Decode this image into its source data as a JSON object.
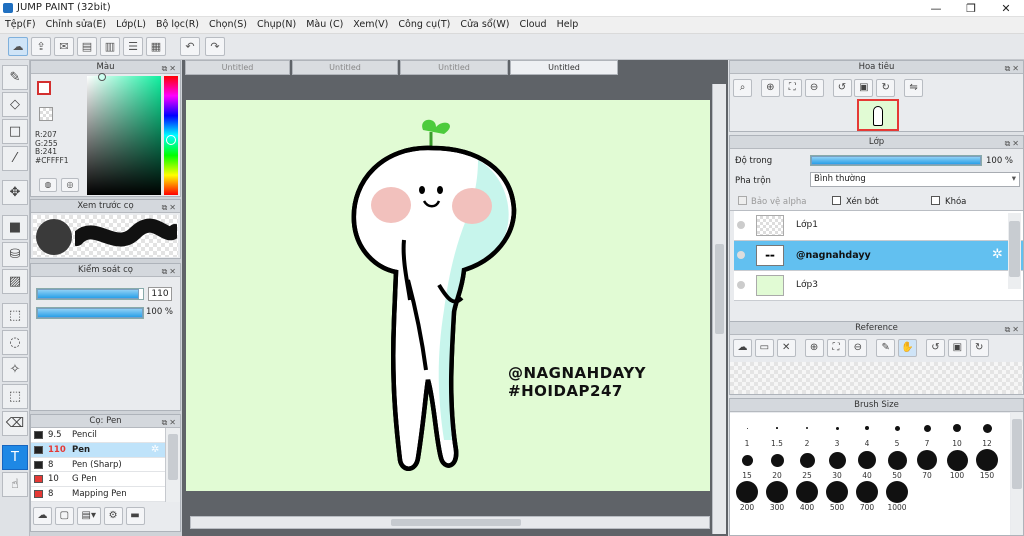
{
  "app": {
    "title": "JUMP PAINT (32bit)"
  },
  "window": {
    "minimize": "—",
    "restore": "❐",
    "close": "✕"
  },
  "menu": [
    "Tệp(F)",
    "Chỉnh sửa(E)",
    "Lớp(L)",
    "Bộ lọc(R)",
    "Chọn(S)",
    "Chụp(N)",
    "Màu (C)",
    "Xem(V)",
    "Công cụ(T)",
    "Cửa sổ(W)",
    "Cloud",
    "Help"
  ],
  "doc_tabs": [
    "Untitled",
    "Untitled",
    "Untitled",
    "Untitled"
  ],
  "color_panel": {
    "title": "Màu",
    "r": "R:207",
    "g": "G:255",
    "b": "B:241",
    "hex": "#CFFFF1",
    "current_color": "#cffff1"
  },
  "preview_panel": {
    "title": "Xem trước cọ"
  },
  "brush_control": {
    "title": "Kiểm soát cọ",
    "size_value": "110",
    "opacity_value": "100 %",
    "size_fraction": 0.96,
    "opacity_fraction": 1.0
  },
  "brush_list": {
    "title": "Cọ: Pen",
    "items": [
      {
        "size": "9.5",
        "name": "Pencil",
        "color": "#222222"
      },
      {
        "size": "110",
        "name": "Pen",
        "color": "#222222"
      },
      {
        "size": "8",
        "name": "Pen (Sharp)",
        "color": "#222222"
      },
      {
        "size": "10",
        "name": "G Pen",
        "color": "#e53935"
      },
      {
        "size": "8",
        "name": "Mapping Pen",
        "color": "#e53935"
      }
    ]
  },
  "canvas": {
    "text_line1": "@NAGNAHDAYY",
    "text_line2": "#HOIDAP247",
    "bg_color": "#e1fbd4"
  },
  "navigator": {
    "title": "Hoa tiêu"
  },
  "layer_panel": {
    "title": "Lớp",
    "opacity_label": "Độ trong",
    "opacity_value": "100 %",
    "opacity_fraction": 1.0,
    "blend_label": "Pha trộn",
    "blend_value": "Bình thường",
    "protect_alpha": "Bảo vệ alpha",
    "clipping": "Xén bớt",
    "lock": "Khóa",
    "layers": [
      {
        "name": "Lớp1",
        "selected": false
      },
      {
        "name": "@nagnahdayy",
        "selected": true
      },
      {
        "name": "Lớp3",
        "selected": false
      }
    ]
  },
  "reference_panel": {
    "title": "Reference"
  },
  "brush_size_panel": {
    "title": "Brush Size",
    "sizes": [
      "1",
      "1.5",
      "2",
      "3",
      "4",
      "5",
      "7",
      "10",
      "12",
      "15",
      "20",
      "25",
      "30",
      "40",
      "50",
      "70",
      "100",
      "150",
      "200",
      "300",
      "400",
      "500",
      "700",
      "1000"
    ]
  }
}
